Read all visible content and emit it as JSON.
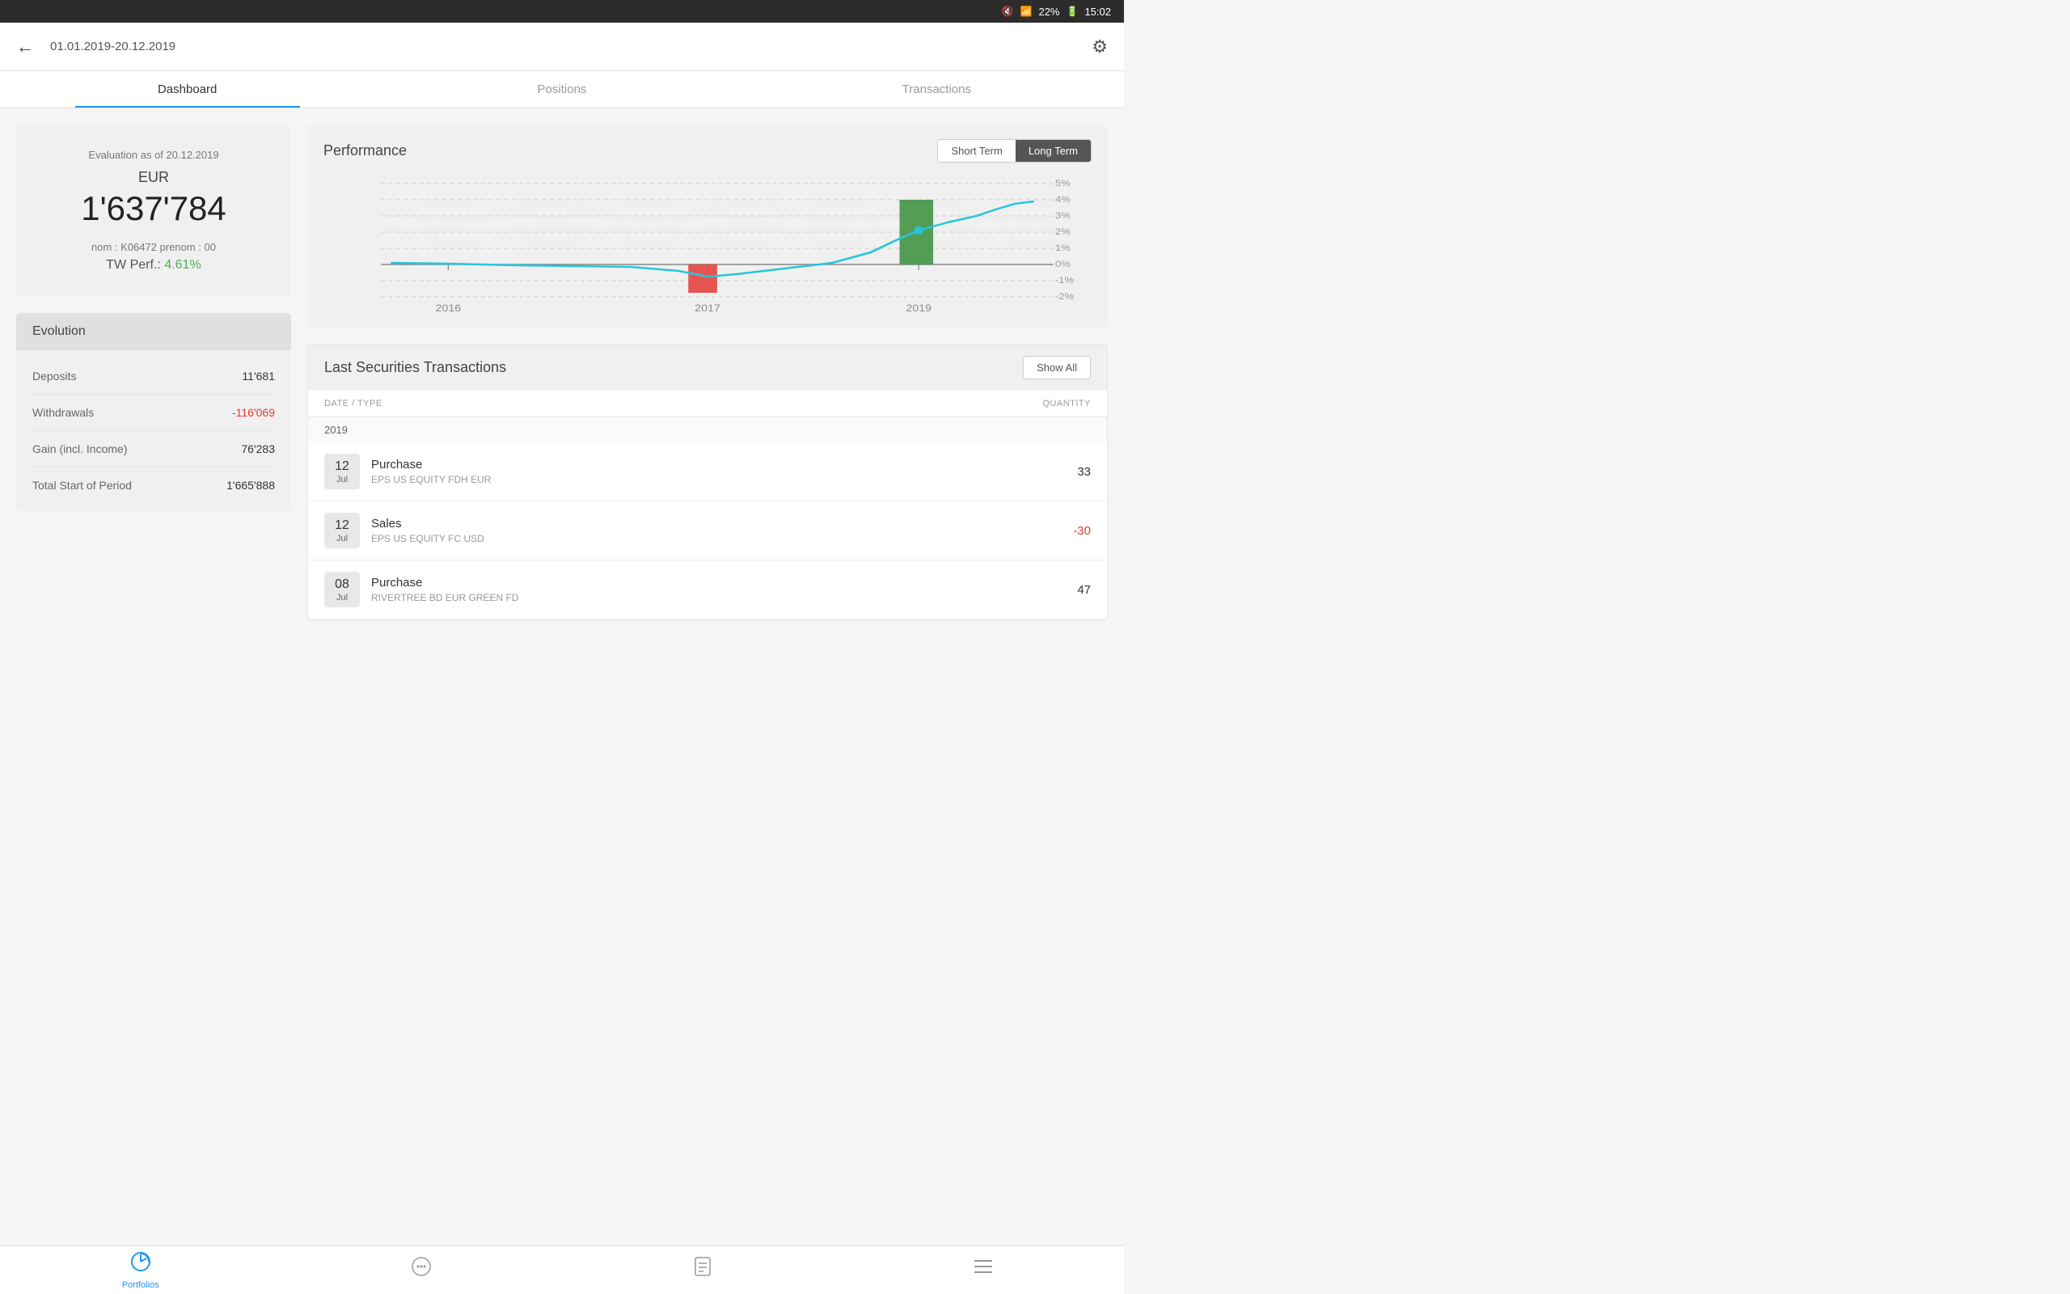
{
  "statusBar": {
    "battery": "22%",
    "time": "15:02"
  },
  "header": {
    "dateRange": "01.01.2019-20.12.2019",
    "backLabel": "←",
    "settingsIcon": "⚙"
  },
  "tabs": [
    {
      "id": "dashboard",
      "label": "Dashboard",
      "active": true
    },
    {
      "id": "positions",
      "label": "Positions",
      "active": false
    },
    {
      "id": "transactions",
      "label": "Transactions",
      "active": false
    }
  ],
  "evaluation": {
    "label": "Evaluation as of 20.12.2019",
    "currency": "EUR",
    "amount": "1'637'784",
    "nom": "nom : K06472 prenom : 00",
    "twPerfLabel": "TW Perf.:",
    "twPerfValue": "4.61%"
  },
  "evolution": {
    "title": "Evolution",
    "rows": [
      {
        "label": "Deposits",
        "value": "11'681",
        "negative": false
      },
      {
        "label": "Withdrawals",
        "value": "-116'069",
        "negative": true
      },
      {
        "label": "Gain (incl. Income)",
        "value": "76'283",
        "negative": false
      },
      {
        "label": "Total Start of Period",
        "value": "1'665'888",
        "negative": false
      }
    ]
  },
  "performance": {
    "title": "Performance",
    "termButtons": [
      {
        "label": "Short Term",
        "active": false
      },
      {
        "label": "Long Term",
        "active": true
      }
    ],
    "chart": {
      "years": [
        "2016",
        "2017",
        "2019"
      ],
      "yLabels": [
        "5%",
        "4%",
        "3%",
        "2%",
        "1%",
        "0%",
        "-1%",
        "-2%"
      ]
    }
  },
  "lastTransactions": {
    "title": "Last Securities Transactions",
    "showAllLabel": "Show All",
    "colDate": "DATE / TYPE",
    "colQty": "QUANTITY",
    "yearGroup": "2019",
    "items": [
      {
        "day": "12",
        "month": "Jul",
        "type": "Purchase",
        "security": "EPS US EQUITY FDH EUR",
        "quantity": "33",
        "negative": false
      },
      {
        "day": "12",
        "month": "Jul",
        "type": "Sales",
        "security": "EPS US EQUITY FC USD",
        "quantity": "-30",
        "negative": true
      },
      {
        "day": "08",
        "month": "Jul",
        "type": "Purchase",
        "security": "RIVERTREE BD EUR GREEN FD",
        "quantity": "47",
        "negative": false
      }
    ]
  },
  "bottomNav": [
    {
      "id": "portfolios",
      "label": "Portfolios",
      "icon": "📊",
      "active": true
    },
    {
      "id": "messages",
      "label": "",
      "icon": "💬",
      "active": false
    },
    {
      "id": "documents",
      "label": "",
      "icon": "📄",
      "active": false
    },
    {
      "id": "menu",
      "label": "",
      "icon": "☰",
      "active": false
    }
  ]
}
